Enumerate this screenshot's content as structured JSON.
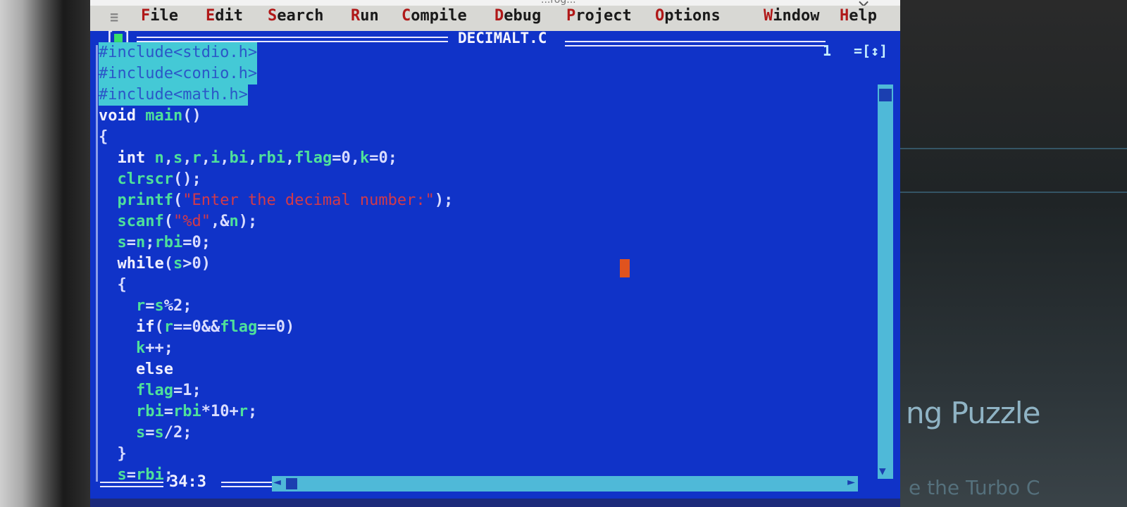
{
  "window": {
    "title": "...rog...",
    "close_symbol": "×"
  },
  "menubar": {
    "system_menu": "≡",
    "items": [
      {
        "hot": "F",
        "rest": "ile"
      },
      {
        "hot": "E",
        "rest": "dit"
      },
      {
        "hot": "S",
        "rest": "earch"
      },
      {
        "hot": "R",
        "rest": "un"
      },
      {
        "hot": "C",
        "rest": "ompile"
      },
      {
        "hot": "D",
        "rest": "ebug"
      },
      {
        "hot": "P",
        "rest": "roject"
      },
      {
        "hot": "O",
        "rest": "ptions"
      },
      {
        "hot": "W",
        "rest": "indow"
      },
      {
        "hot": "H",
        "rest": "elp"
      }
    ]
  },
  "editor": {
    "close_box_left": "[",
    "close_box_mark": "■",
    "close_box_right": "]",
    "filename": "DECIMALT.C",
    "window_number": "1",
    "zoom_box": "=[↕]",
    "cursor_position": "34:3",
    "code_lines": [
      "#include<stdio.h>",
      "#include<conio.h>",
      "#include<math.h>",
      "void main()",
      "{",
      "  int n,s,r,i,bi,rbi,flag=0,k=0;",
      "  clrscr();",
      "  printf(\"Enter the decimal number:\");",
      "  scanf(\"%d\",&n);",
      "  s=n;rbi=0;",
      "  while(s>0)",
      "  {",
      "    r=s%2;",
      "    if(r==0&&flag==0)",
      "    k++;",
      "    else",
      "    flag=1;",
      "    rbi=rbi*10+r;",
      "    s=s/2;",
      "  }",
      "  s=rbi;"
    ]
  },
  "background": {
    "puzzle_text": "ng Puzzle",
    "sub_text": "e the Turbo C"
  },
  "colors": {
    "editor_bg": "#1033c8",
    "menu_bg": "#d8d8d4",
    "menu_hotkey": "#b01818",
    "selection": "#44c9d6",
    "string": "#d23a4a",
    "identifier": "#4fe09a",
    "cursor": "#e0531e",
    "scrollbar": "#4fb9d8"
  }
}
